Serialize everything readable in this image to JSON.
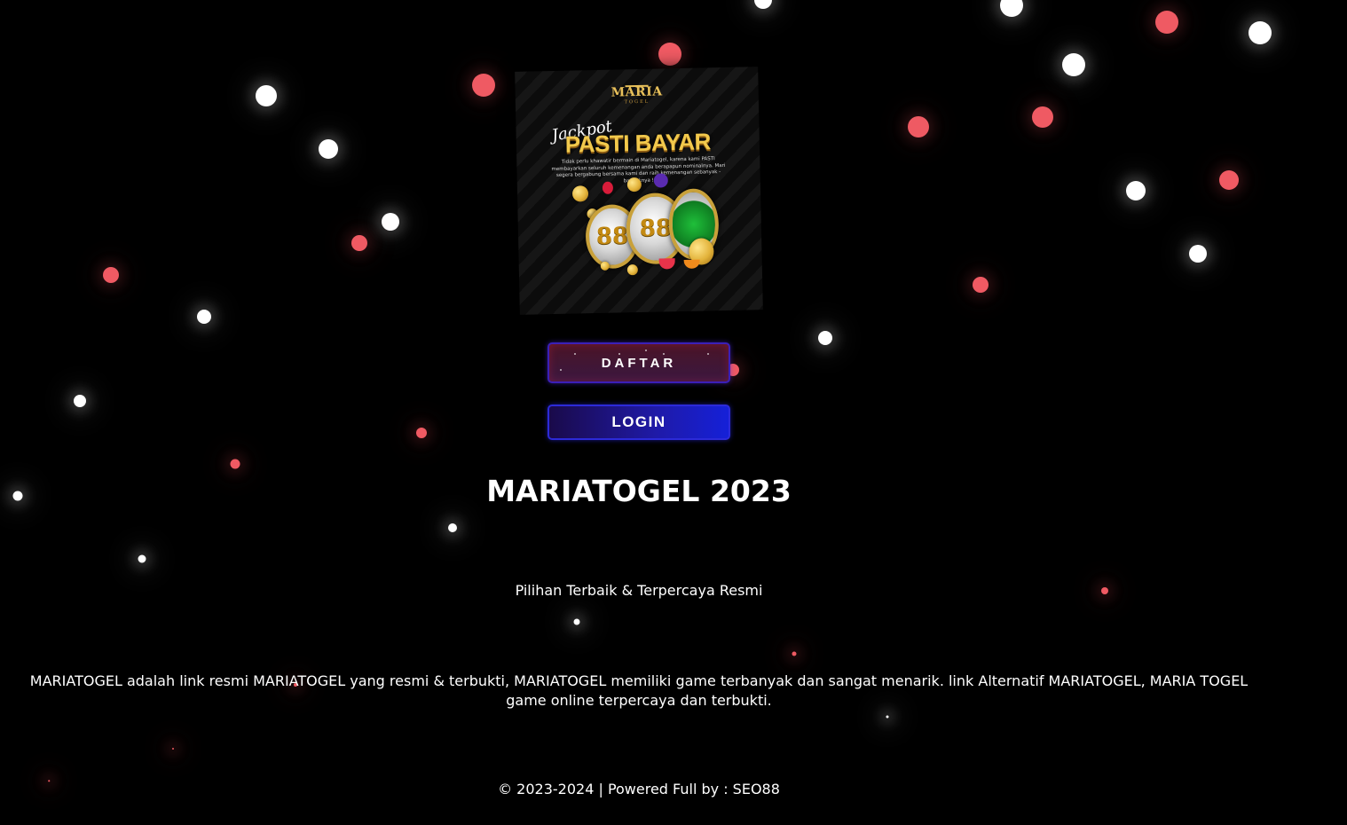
{
  "banner": {
    "logo_text": "MARIA",
    "logo_subtext": "TOGEL",
    "script_text": "Jackpot",
    "headline": "PASTI BAYAR",
    "subtext": "Tidak perlu khawatir bermain di Mariatogel, karena kami PASTI membayarkan seluruh kemenangan anda berapapun nominalnya. Mari segera bergabung bersama kami dan raih kemenangan sebanyak - banyaknya !",
    "reel_label": "88"
  },
  "buttons": {
    "register_label": "DAFTAR",
    "login_label": "LOGIN"
  },
  "main": {
    "title": "MARIATOGEL 2023",
    "tagline": "Pilihan Terbaik & Terpercaya Resmi",
    "description": "MARIATOGEL adalah link resmi MARIATOGEL yang resmi & terbukti, MARIATOGEL memiliki game terbanyak dan sangat menarik. link Alternatif MARIATOGEL, MARIA TOGEL game online terpercaya dan terbukti."
  },
  "footer": {
    "text": "© 2023-2024 | Powered Full by : SEO88"
  },
  "colors": {
    "background": "#000000",
    "particle_red": "#ef5a63",
    "particle_white": "#ffffff",
    "login_blue": "#1f1aa8",
    "register_maroon": "#4a1427"
  }
}
